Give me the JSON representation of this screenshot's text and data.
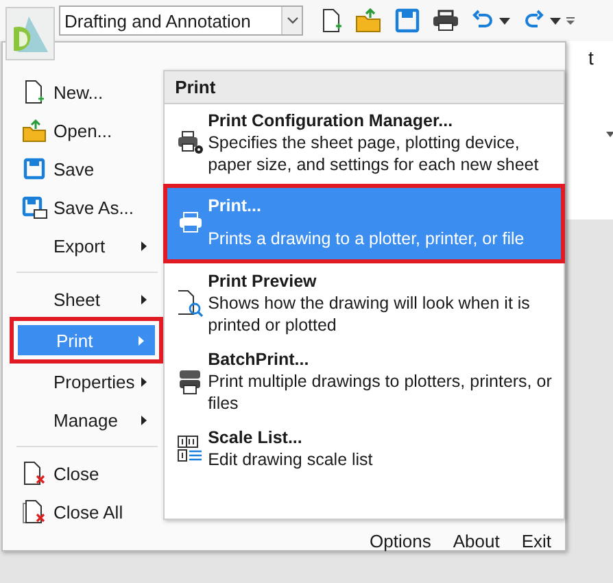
{
  "toolbar": {
    "workspace": "Drafting and Annotation"
  },
  "background_text": "t",
  "menu": {
    "items": [
      {
        "kind": "command",
        "label": "New...",
        "selected": false
      },
      {
        "kind": "command",
        "label": "Open...",
        "selected": false
      },
      {
        "kind": "command",
        "label": "Save",
        "selected": false
      },
      {
        "kind": "command",
        "label": "Save As...",
        "selected": false
      },
      {
        "kind": "submenu",
        "label": "Export",
        "selected": false
      },
      {
        "kind": "separator"
      },
      {
        "kind": "submenu",
        "label": "Sheet",
        "selected": false
      },
      {
        "kind": "submenu",
        "label": "Print",
        "selected": true
      },
      {
        "kind": "submenu",
        "label": "Properties",
        "selected": false
      },
      {
        "kind": "submenu",
        "label": "Manage",
        "selected": false
      },
      {
        "kind": "separator"
      },
      {
        "kind": "command",
        "label": "Close",
        "selected": false
      },
      {
        "kind": "command",
        "label": "Close All",
        "selected": false
      }
    ]
  },
  "submenu": {
    "header": "Print",
    "items": [
      {
        "title": "Print Configuration Manager...",
        "description": "Specifies the sheet page, plotting device, paper size, and settings for each new sheet",
        "selected": false
      },
      {
        "title": "Print...",
        "description": "Prints a drawing to a plotter, printer, or file",
        "selected": true
      },
      {
        "title": "Print Preview",
        "description": "Shows how the drawing will look when it is printed or plotted",
        "selected": false
      },
      {
        "title": "BatchPrint...",
        "description": "Print multiple drawings to plotters, printers, or files",
        "selected": false
      },
      {
        "title": "Scale List...",
        "description": "Edit drawing scale list",
        "selected": false
      }
    ]
  },
  "footer": [
    "Options",
    "About",
    "Exit"
  ]
}
